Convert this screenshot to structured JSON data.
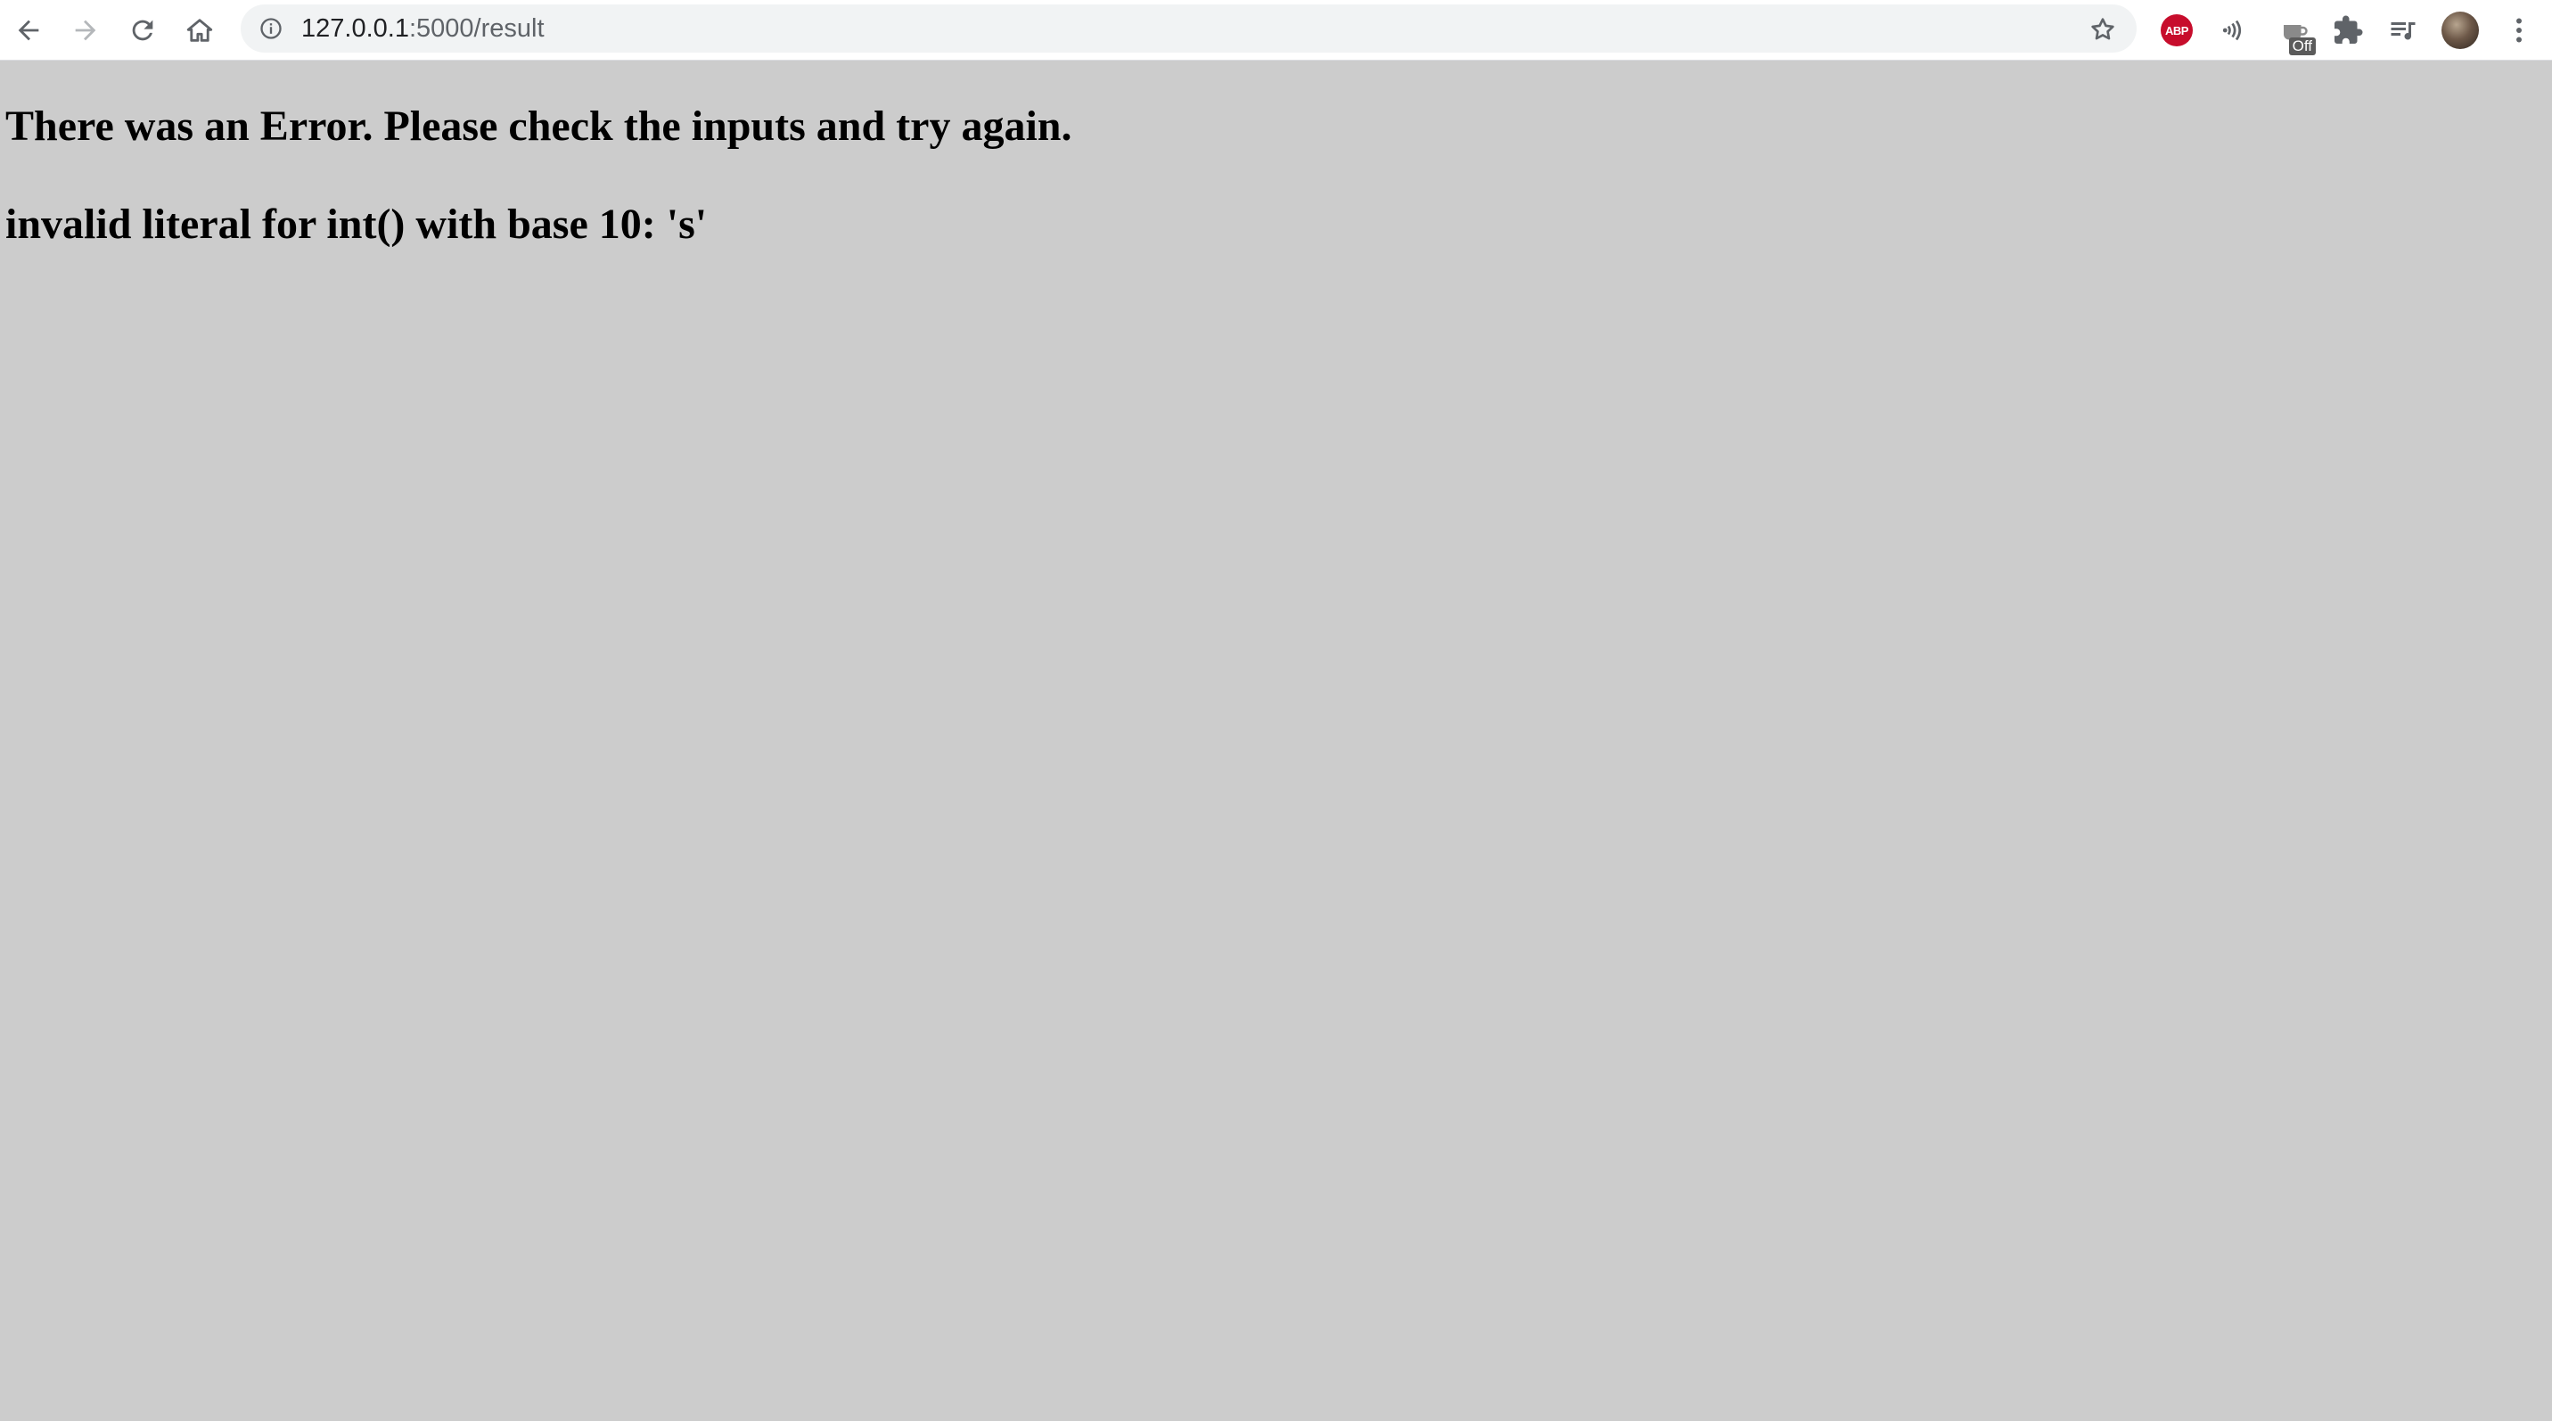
{
  "browser": {
    "url_host": "127.0.0.1",
    "url_path": ":5000/result",
    "extension_badge": "Off",
    "abp_label": "ABP"
  },
  "page": {
    "error_heading": "There was an Error. Please check the inputs and try again.",
    "error_detail": "invalid literal for int() with base 10: 's'"
  },
  "colors": {
    "page_background": "#cccccc",
    "abp_red": "#c70d2c"
  }
}
